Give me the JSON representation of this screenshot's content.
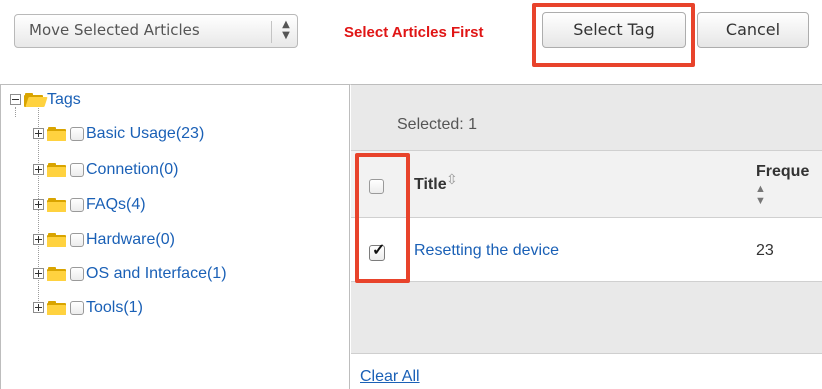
{
  "toolbar": {
    "move_select_value": "Move Selected Articles",
    "warning_text": "Select Articles First",
    "select_tag_label": "Select Tag",
    "cancel_label": "Cancel"
  },
  "tree": {
    "root_label": "Tags",
    "items": [
      {
        "label": "Basic Usage(23)"
      },
      {
        "label": "Connetion(0)"
      },
      {
        "label": "FAQs(4)"
      },
      {
        "label": "Hardware(0)"
      },
      {
        "label": "OS and Interface(1)"
      },
      {
        "label": "Tools(1)"
      }
    ]
  },
  "grid": {
    "selected_label": "Selected:",
    "selected_count": "1",
    "columns": {
      "title": "Title",
      "frequency": "Freque"
    },
    "rows": [
      {
        "title": "Resetting the device",
        "frequency": "23",
        "checked": true
      }
    ],
    "clear_all_label": "Clear All"
  },
  "colors": {
    "highlight": "#e8432b",
    "warning": "#e01515",
    "link": "#1a60b6"
  }
}
